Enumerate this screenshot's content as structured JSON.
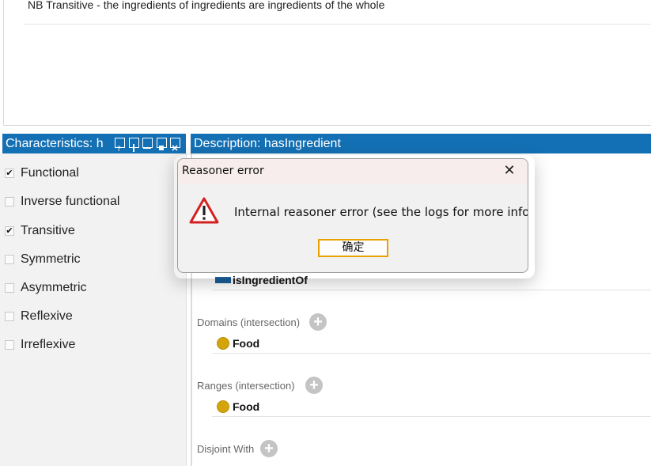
{
  "annotation": {
    "text": "NB Transitive - the ingredients of ingredients are ingredients of the whole"
  },
  "characteristics_panel": {
    "title": "Characteristics: h",
    "header_buttons": [
      "help-icon",
      "split-vertical-icon",
      "split-horizontal-icon",
      "maximize-icon",
      "close-icon"
    ],
    "items": [
      {
        "label": "Functional",
        "checked": true
      },
      {
        "label": "Inverse functional",
        "checked": false
      },
      {
        "label": "Transitive",
        "checked": true
      },
      {
        "label": "Symmetric",
        "checked": false
      },
      {
        "label": "Asymmetric",
        "checked": false
      },
      {
        "label": "Reflexive",
        "checked": false
      },
      {
        "label": "Irreflexive",
        "checked": false
      }
    ]
  },
  "description_panel": {
    "title": "Description: hasIngredient",
    "inverse_of": {
      "entry": "isIngredientOf"
    },
    "domains": {
      "label": "Domains (intersection)",
      "entry": "Food"
    },
    "ranges": {
      "label": "Ranges (intersection)",
      "entry": "Food"
    },
    "disjoint_with": {
      "label": "Disjoint With"
    },
    "add_symbol": "+"
  },
  "dialog": {
    "title": "Reasoner error",
    "close_symbol": "✕",
    "message": "Internal reasoner error (see the logs for more info).",
    "ok_label": "确定"
  },
  "colors": {
    "header_bg": "#1470b4",
    "class_dot": "#d4a40c",
    "property_swatch": "#1a5f99",
    "dialog_button_border": "#e8a200",
    "warning_red": "#d42020"
  }
}
